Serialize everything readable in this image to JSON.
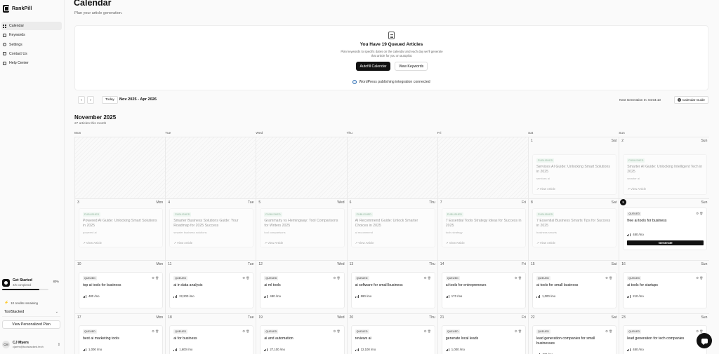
{
  "app": {
    "name": "RankPill"
  },
  "sidebar": {
    "items": [
      {
        "label": "Calendar",
        "icon": "calendar-grid-icon",
        "active": true
      },
      {
        "label": "Keywords",
        "icon": "keywords-icon"
      },
      {
        "label": "Settings",
        "icon": "settings-icon"
      },
      {
        "label": "Contact Us",
        "icon": "mail-icon"
      },
      {
        "label": "Help Center",
        "icon": "help-icon"
      }
    ],
    "get_started": {
      "title": "Get Started",
      "subtitle": "4/5 completed",
      "percent_label": "80%",
      "progress": 0.8
    },
    "credits": "10 credits remaining",
    "workspace": "ToolStacked",
    "plan_button": "View Personalized Plan",
    "user": {
      "initials": "CM",
      "name": "CJ Myers",
      "email": "cjartm@toolstacked.tech"
    }
  },
  "header": {
    "title": "Calendar",
    "subtitle": "Plan your article generation."
  },
  "queue": {
    "title": "You Have 19 Queued Articles",
    "description": "Plan keywords to specific dates on the calendar and each day we'll generate that article for you on autopilot.",
    "autofill_label": "Autofill Calendar",
    "view_keywords_label": "View Keywords",
    "wordpress_status": "WordPress publishing integration connected"
  },
  "controls": {
    "today_label": "Today",
    "range": "Nov 2025 - Apr 2026",
    "next_generation": "Next Generation In: 04:04:10",
    "guide_label": "Calendar Guide"
  },
  "month": {
    "title": "November 2025",
    "subtitle": "27 articles this month"
  },
  "weekdays": [
    "Mon",
    "Tue",
    "Wed",
    "Thu",
    "Fri",
    "Sat",
    "Sun"
  ],
  "labels": {
    "view_article": "View Article",
    "generate": "Generate",
    "published": "PUBLISHED",
    "queued": "QUEUED"
  },
  "weeks": [
    [
      {
        "empty": true
      },
      {
        "empty": true
      },
      {
        "empty": true
      },
      {
        "empty": true
      },
      {
        "empty": true
      },
      {
        "day": "1",
        "dow": "Sat",
        "status": "published",
        "title": "Services AI Guide: Unlocking Smart Solutions in 2025",
        "keyword": "services ai"
      },
      {
        "day": "2",
        "dow": "Sun",
        "status": "published",
        "title": "Smarter AI Guide: Unlocking Intelligent Tech in 2025",
        "keyword": "smarter ai"
      }
    ],
    [
      {
        "day": "3",
        "dow": "Mon",
        "status": "published",
        "title": "Powered AI Guide: Unlocking Smart Solutions in 2025",
        "keyword": "powered ai"
      },
      {
        "day": "4",
        "dow": "Tue",
        "status": "published",
        "title": "Smarter Business Solutions Guide: Your Roadmap for 2025 Success",
        "keyword": "smarter business solutions"
      },
      {
        "day": "5",
        "dow": "Wed",
        "status": "published",
        "title": "Grammarly vs Hemingway: Tool Comparisons for Writers 2025",
        "keyword": "tool comparisons"
      },
      {
        "day": "6",
        "dow": "Thu",
        "status": "published",
        "title": "AI Recommend Guide: Unlock Smarter Choices in 2025",
        "keyword": "ai recommend"
      },
      {
        "day": "7",
        "dow": "Fri",
        "status": "published",
        "title": "7 Essential Tools Strategy Ideas for Success in 2025",
        "keyword": "tools strategy"
      },
      {
        "day": "8",
        "dow": "Sat",
        "status": "published",
        "title": "7 Essential Business Smarts Tips for Success in 2025",
        "keyword": "business smarts"
      },
      {
        "day": "9",
        "dow": "Sun",
        "status": "queued",
        "title": "free ai tools for business",
        "volume": "480 /mo",
        "today": true
      }
    ],
    [
      {
        "day": "10",
        "dow": "Mon",
        "status": "queued",
        "title": "top ai tools for business",
        "volume": "480 /mo"
      },
      {
        "day": "11",
        "dow": "Tue",
        "status": "queued",
        "title": "ai in data analysis",
        "volume": "22,200 /mo"
      },
      {
        "day": "12",
        "dow": "Wed",
        "status": "queued",
        "title": "ai ml tools",
        "volume": "480 /mo"
      },
      {
        "day": "13",
        "dow": "Thu",
        "status": "queued",
        "title": "ai software for small business",
        "volume": "590 /mo"
      },
      {
        "day": "14",
        "dow": "Fri",
        "status": "queued",
        "title": "ai tools for entrepreneurs",
        "volume": "170 /mo"
      },
      {
        "day": "15",
        "dow": "Sat",
        "status": "queued",
        "title": "ai tools for small business",
        "volume": "1,000 /mo"
      },
      {
        "day": "16",
        "dow": "Sun",
        "status": "queued",
        "title": "ai tools for startups",
        "volume": "210 /mo"
      }
    ],
    [
      {
        "day": "17",
        "dow": "Mon",
        "status": "queued",
        "title": "best ai marketing tools",
        "volume": "1,000 /mo"
      },
      {
        "day": "18",
        "dow": "Tue",
        "status": "queued",
        "title": "ai for business",
        "volume": "1,600 /mo"
      },
      {
        "day": "19",
        "dow": "Wed",
        "status": "queued",
        "title": "ai and automation",
        "volume": "27,100 /mo"
      },
      {
        "day": "20",
        "dow": "Thu",
        "status": "queued",
        "title": "reviews ai",
        "volume": "12,100 /mo"
      },
      {
        "day": "21",
        "dow": "Fri",
        "status": "queued",
        "title": "generate local leads",
        "volume": "1,000 /mo"
      },
      {
        "day": "22",
        "dow": "Sat",
        "status": "queued",
        "title": "lead generation companies for small businesses",
        "volume": "480 /mo"
      },
      {
        "day": "23",
        "dow": "Sun",
        "status": "queued",
        "title": "lead generation for tech companies",
        "volume": "480 /mo"
      }
    ]
  ]
}
